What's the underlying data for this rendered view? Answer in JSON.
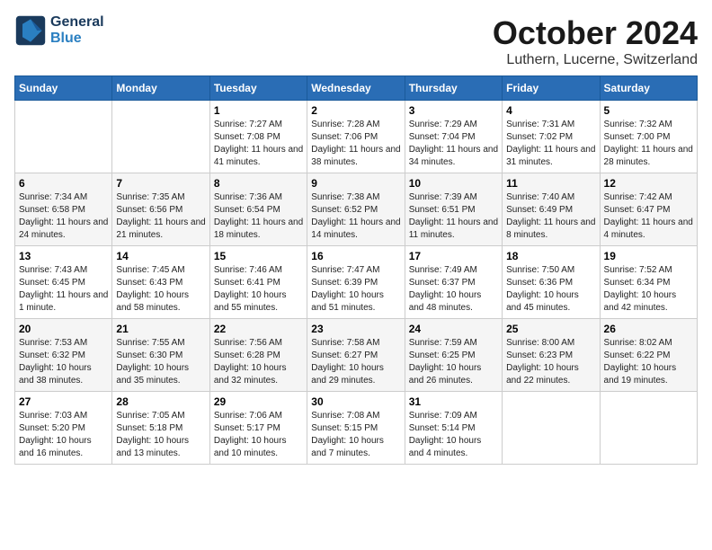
{
  "header": {
    "logo_line1": "General",
    "logo_line2": "Blue",
    "month": "October 2024",
    "location": "Luthern, Lucerne, Switzerland"
  },
  "weekdays": [
    "Sunday",
    "Monday",
    "Tuesday",
    "Wednesday",
    "Thursday",
    "Friday",
    "Saturday"
  ],
  "weeks": [
    [
      {
        "day": "",
        "info": ""
      },
      {
        "day": "",
        "info": ""
      },
      {
        "day": "1",
        "info": "Sunrise: 7:27 AM\nSunset: 7:08 PM\nDaylight: 11 hours and 41 minutes."
      },
      {
        "day": "2",
        "info": "Sunrise: 7:28 AM\nSunset: 7:06 PM\nDaylight: 11 hours and 38 minutes."
      },
      {
        "day": "3",
        "info": "Sunrise: 7:29 AM\nSunset: 7:04 PM\nDaylight: 11 hours and 34 minutes."
      },
      {
        "day": "4",
        "info": "Sunrise: 7:31 AM\nSunset: 7:02 PM\nDaylight: 11 hours and 31 minutes."
      },
      {
        "day": "5",
        "info": "Sunrise: 7:32 AM\nSunset: 7:00 PM\nDaylight: 11 hours and 28 minutes."
      }
    ],
    [
      {
        "day": "6",
        "info": "Sunrise: 7:34 AM\nSunset: 6:58 PM\nDaylight: 11 hours and 24 minutes."
      },
      {
        "day": "7",
        "info": "Sunrise: 7:35 AM\nSunset: 6:56 PM\nDaylight: 11 hours and 21 minutes."
      },
      {
        "day": "8",
        "info": "Sunrise: 7:36 AM\nSunset: 6:54 PM\nDaylight: 11 hours and 18 minutes."
      },
      {
        "day": "9",
        "info": "Sunrise: 7:38 AM\nSunset: 6:52 PM\nDaylight: 11 hours and 14 minutes."
      },
      {
        "day": "10",
        "info": "Sunrise: 7:39 AM\nSunset: 6:51 PM\nDaylight: 11 hours and 11 minutes."
      },
      {
        "day": "11",
        "info": "Sunrise: 7:40 AM\nSunset: 6:49 PM\nDaylight: 11 hours and 8 minutes."
      },
      {
        "day": "12",
        "info": "Sunrise: 7:42 AM\nSunset: 6:47 PM\nDaylight: 11 hours and 4 minutes."
      }
    ],
    [
      {
        "day": "13",
        "info": "Sunrise: 7:43 AM\nSunset: 6:45 PM\nDaylight: 11 hours and 1 minute."
      },
      {
        "day": "14",
        "info": "Sunrise: 7:45 AM\nSunset: 6:43 PM\nDaylight: 10 hours and 58 minutes."
      },
      {
        "day": "15",
        "info": "Sunrise: 7:46 AM\nSunset: 6:41 PM\nDaylight: 10 hours and 55 minutes."
      },
      {
        "day": "16",
        "info": "Sunrise: 7:47 AM\nSunset: 6:39 PM\nDaylight: 10 hours and 51 minutes."
      },
      {
        "day": "17",
        "info": "Sunrise: 7:49 AM\nSunset: 6:37 PM\nDaylight: 10 hours and 48 minutes."
      },
      {
        "day": "18",
        "info": "Sunrise: 7:50 AM\nSunset: 6:36 PM\nDaylight: 10 hours and 45 minutes."
      },
      {
        "day": "19",
        "info": "Sunrise: 7:52 AM\nSunset: 6:34 PM\nDaylight: 10 hours and 42 minutes."
      }
    ],
    [
      {
        "day": "20",
        "info": "Sunrise: 7:53 AM\nSunset: 6:32 PM\nDaylight: 10 hours and 38 minutes."
      },
      {
        "day": "21",
        "info": "Sunrise: 7:55 AM\nSunset: 6:30 PM\nDaylight: 10 hours and 35 minutes."
      },
      {
        "day": "22",
        "info": "Sunrise: 7:56 AM\nSunset: 6:28 PM\nDaylight: 10 hours and 32 minutes."
      },
      {
        "day": "23",
        "info": "Sunrise: 7:58 AM\nSunset: 6:27 PM\nDaylight: 10 hours and 29 minutes."
      },
      {
        "day": "24",
        "info": "Sunrise: 7:59 AM\nSunset: 6:25 PM\nDaylight: 10 hours and 26 minutes."
      },
      {
        "day": "25",
        "info": "Sunrise: 8:00 AM\nSunset: 6:23 PM\nDaylight: 10 hours and 22 minutes."
      },
      {
        "day": "26",
        "info": "Sunrise: 8:02 AM\nSunset: 6:22 PM\nDaylight: 10 hours and 19 minutes."
      }
    ],
    [
      {
        "day": "27",
        "info": "Sunrise: 7:03 AM\nSunset: 5:20 PM\nDaylight: 10 hours and 16 minutes."
      },
      {
        "day": "28",
        "info": "Sunrise: 7:05 AM\nSunset: 5:18 PM\nDaylight: 10 hours and 13 minutes."
      },
      {
        "day": "29",
        "info": "Sunrise: 7:06 AM\nSunset: 5:17 PM\nDaylight: 10 hours and 10 minutes."
      },
      {
        "day": "30",
        "info": "Sunrise: 7:08 AM\nSunset: 5:15 PM\nDaylight: 10 hours and 7 minutes."
      },
      {
        "day": "31",
        "info": "Sunrise: 7:09 AM\nSunset: 5:14 PM\nDaylight: 10 hours and 4 minutes."
      },
      {
        "day": "",
        "info": ""
      },
      {
        "day": "",
        "info": ""
      }
    ]
  ]
}
